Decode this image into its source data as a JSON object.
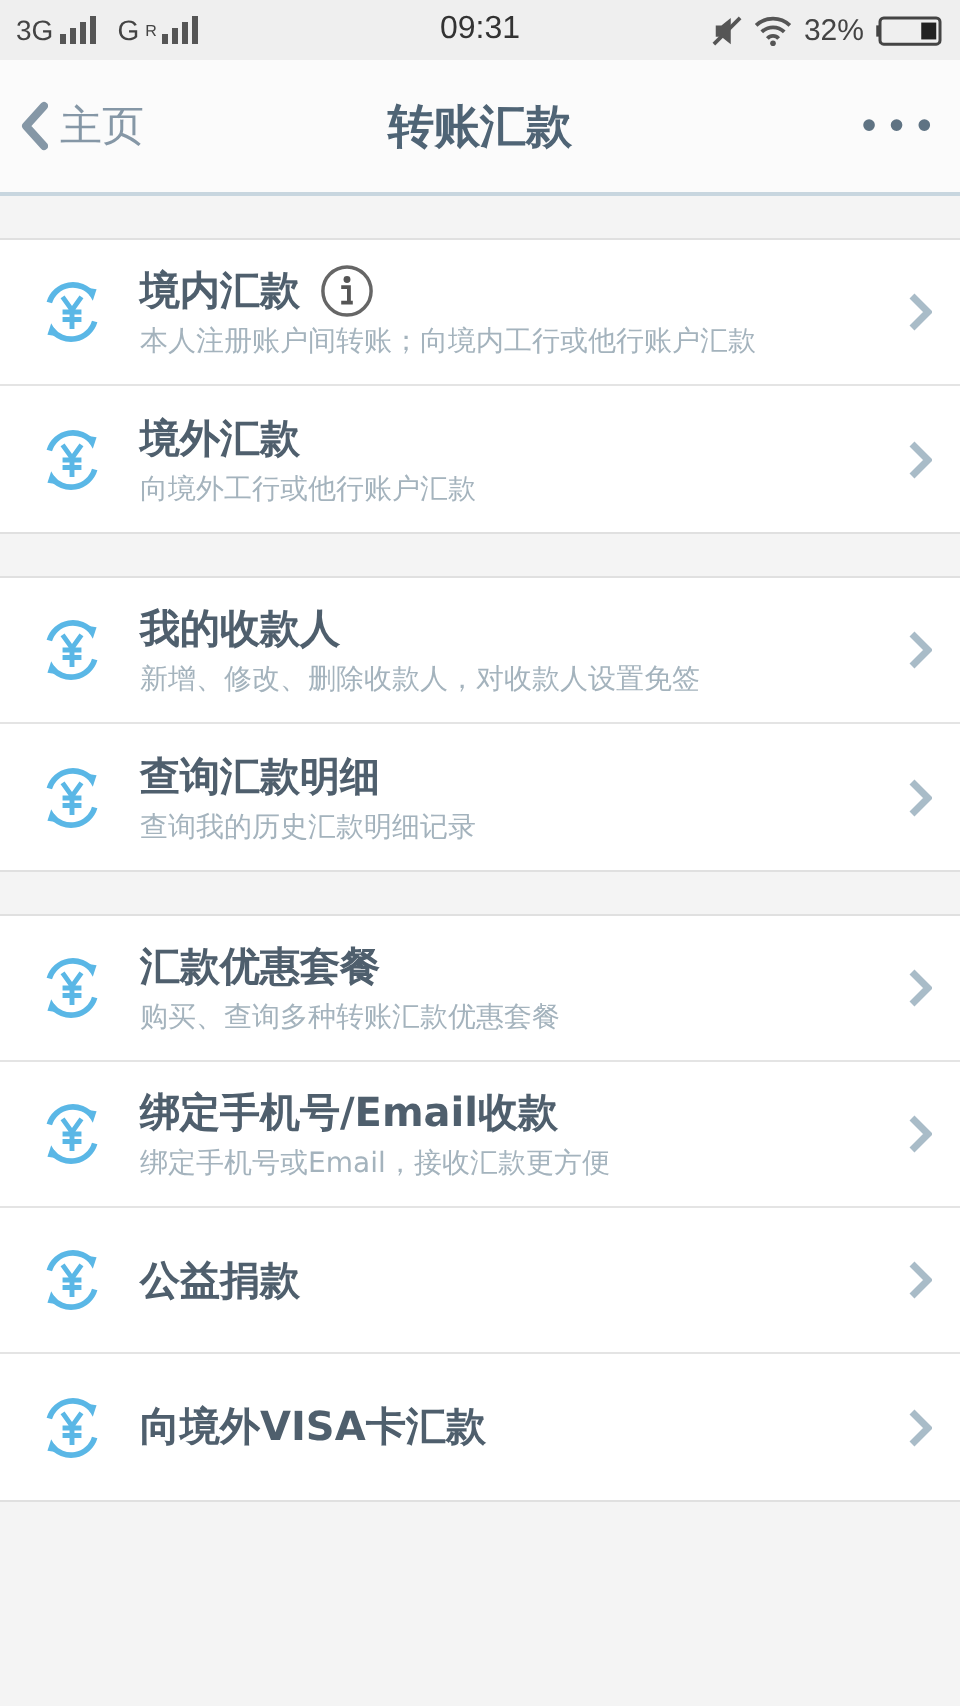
{
  "status_bar": {
    "network_1": "3G",
    "network_2": "G",
    "network_2_mark": "R",
    "time": "09:31",
    "battery": "32%"
  },
  "nav": {
    "back": "主页",
    "title": "转账汇款",
    "more": "•••"
  },
  "groups": [
    {
      "items": [
        {
          "title": "境内汇款",
          "subtitle": "本人注册账户间转账；向境内工行或他行账户汇款",
          "info": true
        },
        {
          "title": "境外汇款",
          "subtitle": "向境外工行或他行账户汇款",
          "info": false
        }
      ]
    },
    {
      "items": [
        {
          "title": "我的收款人",
          "subtitle": "新增、修改、删除收款人，对收款人设置免签",
          "info": false
        },
        {
          "title": "查询汇款明细",
          "subtitle": "查询我的历史汇款明细记录",
          "info": false
        }
      ]
    },
    {
      "items": [
        {
          "title": "汇款优惠套餐",
          "subtitle": "购买、查询多种转账汇款优惠套餐",
          "info": false
        },
        {
          "title": "绑定手机号/Email收款",
          "subtitle": "绑定手机号或Email，接收汇款更方便",
          "info": false
        },
        {
          "title": "公益捐款",
          "info": false
        },
        {
          "title": "向境外VISA卡汇款",
          "info": false
        }
      ]
    }
  ]
}
